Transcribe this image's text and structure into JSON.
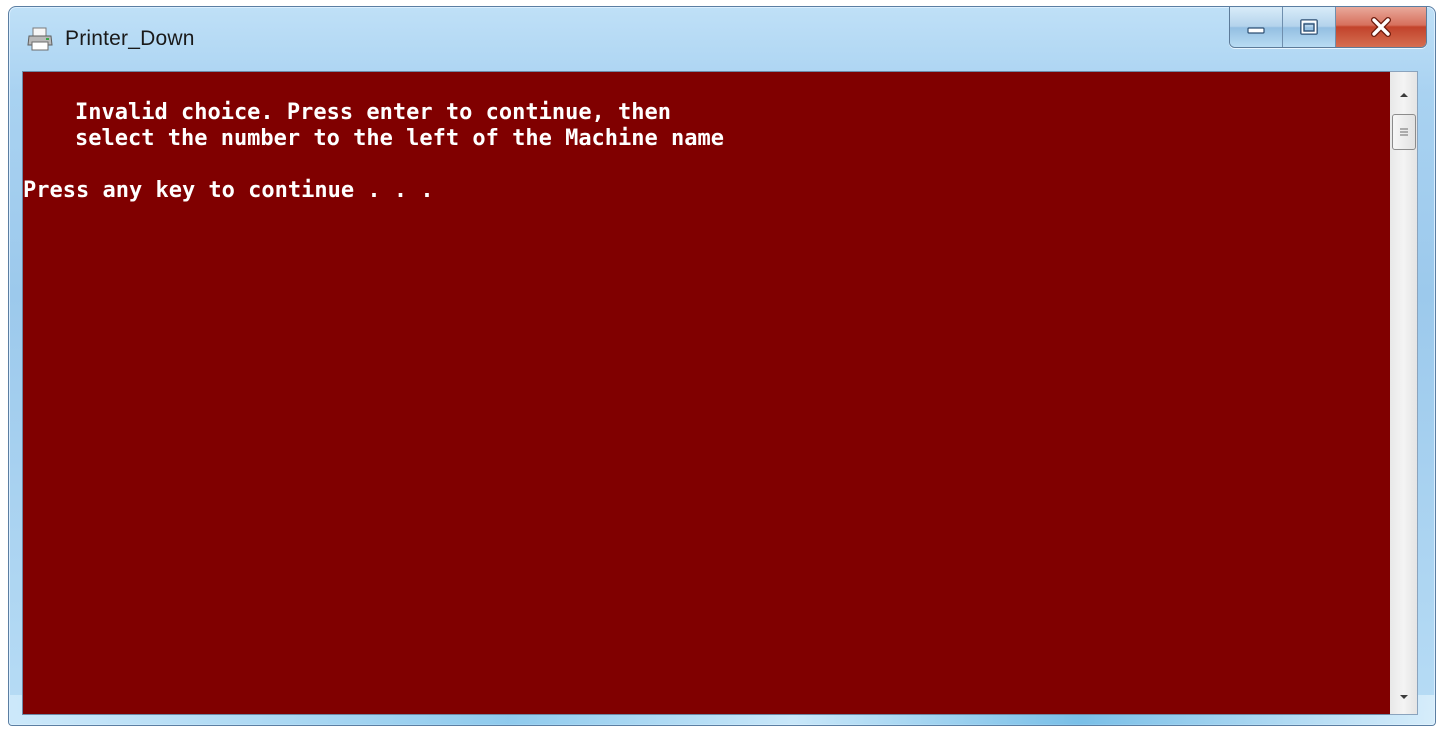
{
  "window": {
    "title": "Printer_Down",
    "icon": "printer-icon"
  },
  "caption_buttons": {
    "minimize_icon": "minimize-icon",
    "maximize_icon": "maximize-icon",
    "close_icon": "close-icon"
  },
  "console": {
    "background_color": "#800000",
    "text_color": "#ffffff",
    "line1": "Invalid choice. Press enter to continue, then",
    "line2": "select the number to the left of the Machine name",
    "prompt": "Press any key to continue . . ."
  },
  "scrollbar": {
    "up_icon": "scroll-up-arrow-icon",
    "down_icon": "scroll-down-arrow-icon",
    "thumb_icon": "scroll-thumb-grip-icon"
  }
}
